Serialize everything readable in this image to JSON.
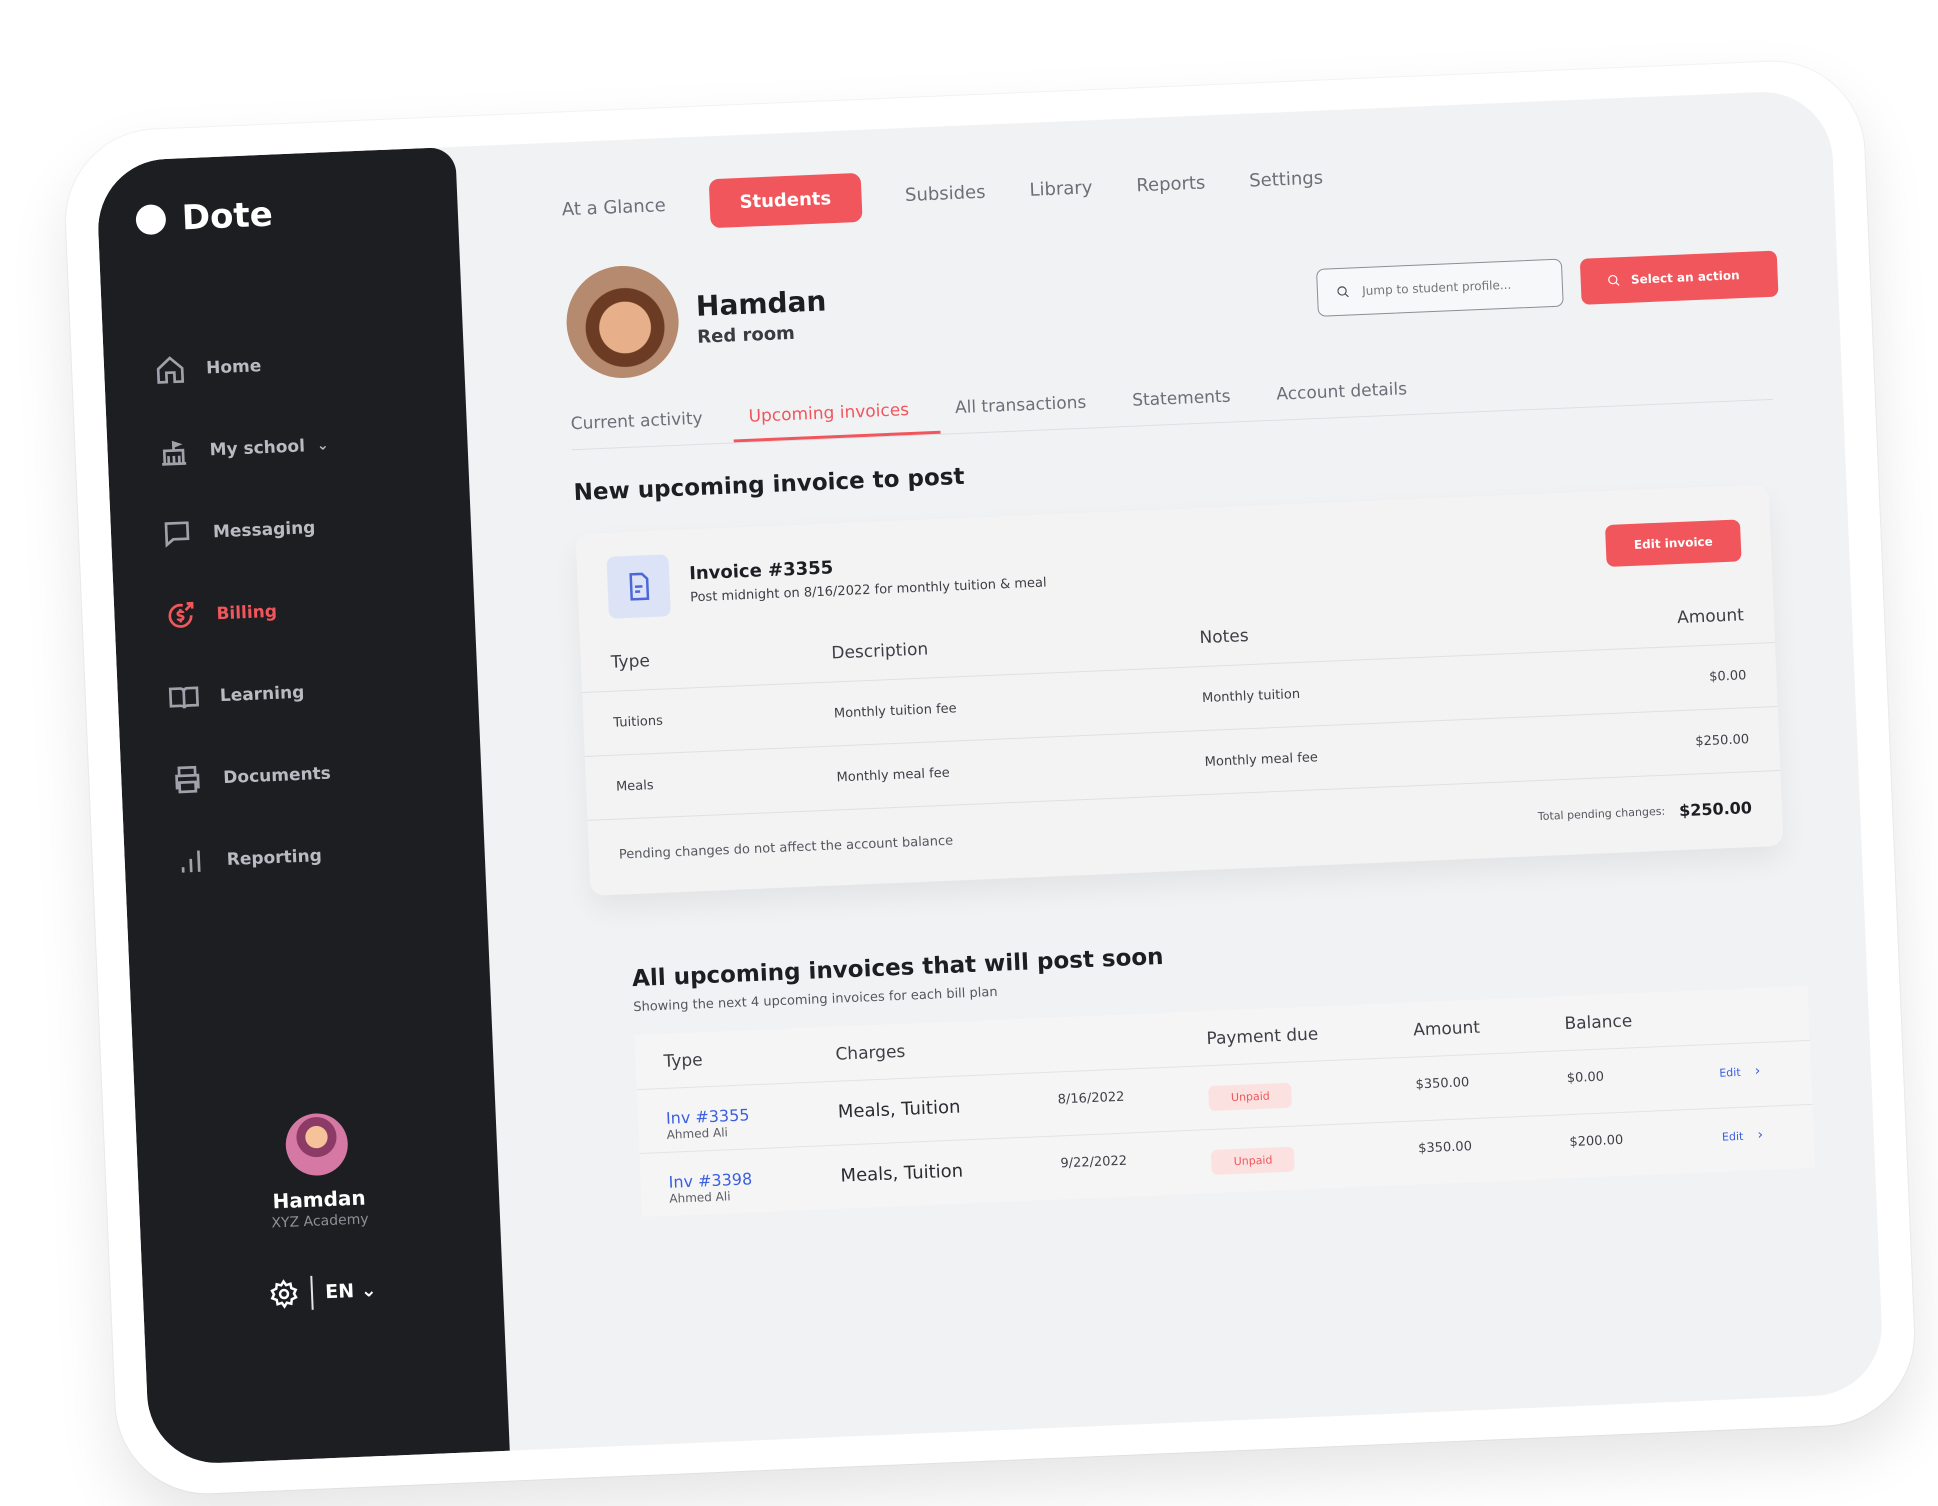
{
  "brand": {
    "name": "Dote"
  },
  "sidebar": {
    "items": [
      {
        "label": "Home",
        "icon": "home-icon",
        "active": false
      },
      {
        "label": "My school",
        "icon": "school-icon",
        "active": false,
        "has_dropdown": true
      },
      {
        "label": "Messaging",
        "icon": "message-icon",
        "active": false
      },
      {
        "label": "Billing",
        "icon": "billing-icon",
        "active": true
      },
      {
        "label": "Learning",
        "icon": "book-icon",
        "active": false
      },
      {
        "label": "Documents",
        "icon": "printer-icon",
        "active": false
      },
      {
        "label": "Reporting",
        "icon": "bar-chart-icon",
        "active": false
      }
    ],
    "user": {
      "name": "Hamdan",
      "org": "XYZ Academy"
    },
    "language": "EN"
  },
  "topnav": {
    "tabs": [
      "At a Glance",
      "Students",
      "Subsides",
      "Library",
      "Reports",
      "Settings"
    ],
    "active": "Students"
  },
  "student": {
    "name": "Hamdan",
    "room": "Red room"
  },
  "search": {
    "placeholder": "Jump to student profile..."
  },
  "action_button": {
    "label": "Select an action"
  },
  "subtabs": {
    "items": [
      "Current activity",
      "Upcoming invoices",
      "All transactions",
      "Statements",
      "Account details"
    ],
    "active": "Upcoming invoices"
  },
  "new_invoice": {
    "section_title": "New upcoming invoice to post",
    "title": "Invoice #3355",
    "subtitle": "Post midnight on 8/16/2022 for monthly tuition & meal",
    "edit_label": "Edit invoice",
    "columns": {
      "type": "Type",
      "description": "Description",
      "notes": "Notes",
      "amount": "Amount"
    },
    "rows": [
      {
        "type": "Tuitions",
        "description": "Monthly tuition fee",
        "notes": "Monthly tuition",
        "amount": "$0.00"
      },
      {
        "type": "Meals",
        "description": "Monthly meal fee",
        "notes": "Monthly meal fee",
        "amount": "$250.00"
      }
    ],
    "footer_note": "Pending changes do not affect the account balance",
    "total_label": "Total pending changes:",
    "total": "$250.00"
  },
  "upcoming": {
    "title": "All upcoming invoices that will post soon",
    "subtitle": "Showing the next 4 upcoming invoices for each bill plan",
    "columns": {
      "type": "Type",
      "charges": "Charges",
      "payment_due": "Payment due",
      "amount": "Amount",
      "balance": "Balance"
    },
    "rows": [
      {
        "invoice": "Inv #3355",
        "name": "Ahmed Ali",
        "charges": "Meals, Tuition",
        "date": "8/16/2022",
        "status": "Unpaid",
        "amount": "$350.00",
        "balance": "$0.00",
        "edit": "Edit"
      },
      {
        "invoice": "Inv #3398",
        "name": "Ahmed Ali",
        "charges": "Meals, Tuition",
        "date": "9/22/2022",
        "status": "Unpaid",
        "amount": "$350.00",
        "balance": "$200.00",
        "edit": "Edit"
      }
    ]
  },
  "colors": {
    "accent": "#f0565b",
    "sidebar_bg": "#1d1e22",
    "link": "#3c5fe0",
    "content_bg": "#f1f2f4"
  }
}
